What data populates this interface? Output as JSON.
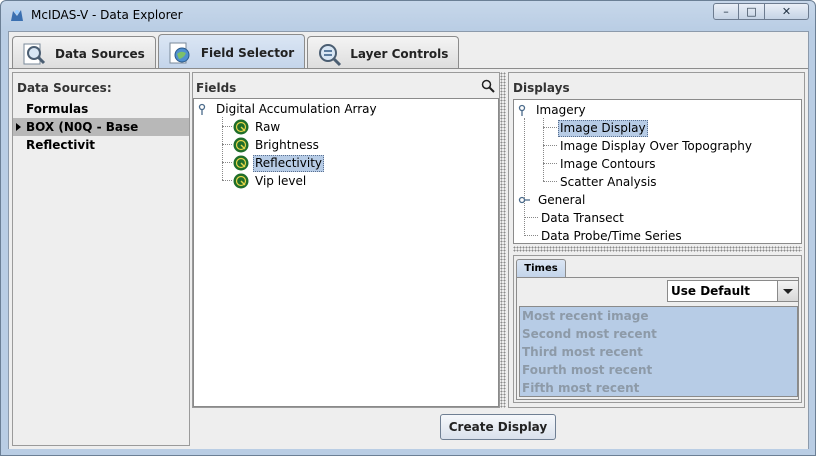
{
  "window": {
    "title": "McIDAS-V - Data Explorer",
    "controls": {
      "minimize": "–",
      "maximize": "□",
      "close": "✕"
    }
  },
  "tabs": [
    {
      "label": "Data Sources",
      "icon": "magnifier-doc-icon"
    },
    {
      "label": "Field Selector",
      "icon": "globe-doc-icon"
    },
    {
      "label": "Layer Controls",
      "icon": "magnifier-layers-icon"
    }
  ],
  "data_sources": {
    "heading": "Data Sources:",
    "items": [
      {
        "label": "Formulas"
      },
      {
        "label": "BOX (N0Q - Base Reflectivit"
      }
    ]
  },
  "fields": {
    "heading": "Fields",
    "root": "Digital Accumulation Array",
    "items": [
      {
        "label": "Raw"
      },
      {
        "label": "Brightness"
      },
      {
        "label": "Reflectivity"
      },
      {
        "label": "Vip level"
      }
    ]
  },
  "displays": {
    "heading": "Displays",
    "imagery": "Imagery",
    "imagery_items": [
      {
        "label": "Image Display"
      },
      {
        "label": "Image Display Over Topography"
      },
      {
        "label": "Image Contours"
      },
      {
        "label": "Scatter Analysis"
      }
    ],
    "general": "General",
    "other_items": [
      {
        "label": "Data Transect"
      },
      {
        "label": "Data Probe/Time Series"
      }
    ]
  },
  "times": {
    "tab_label": "Times",
    "selection": "Use Default",
    "items": [
      {
        "label": "Most recent image"
      },
      {
        "label": "Second most recent"
      },
      {
        "label": "Third most recent"
      },
      {
        "label": "Fourth most recent"
      },
      {
        "label": "Fifth most recent"
      }
    ]
  },
  "actions": {
    "create_display": "Create Display"
  },
  "colors": {
    "selection": "#b7cce6",
    "accent": "#c3d4ea"
  }
}
